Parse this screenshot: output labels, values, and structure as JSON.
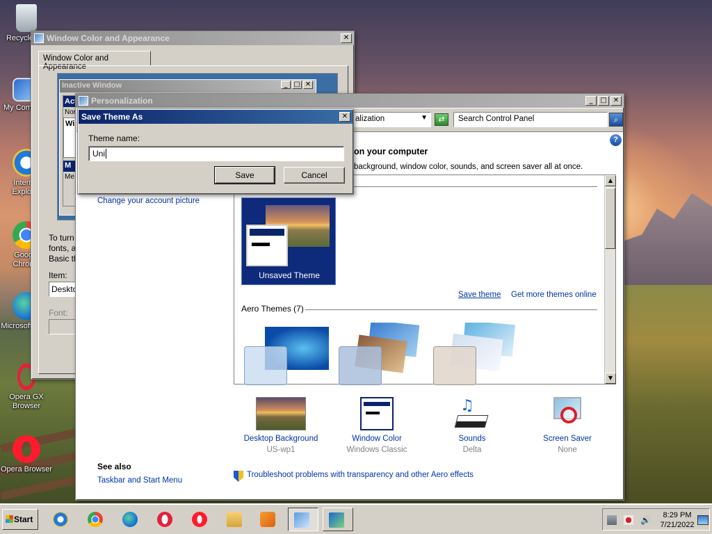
{
  "desktop": {
    "icons": [
      {
        "name": "recycle-bin",
        "label": "Recycle Bin"
      },
      {
        "name": "my-computer",
        "label": "My Computer"
      },
      {
        "name": "internet-explorer",
        "label": "Internet Explorer"
      },
      {
        "name": "google-chrome",
        "label": "Google Chrome"
      },
      {
        "name": "microsoft-edge",
        "label": "Microsoft Edge"
      },
      {
        "name": "opera-gx",
        "label": "Opera GX Browser"
      },
      {
        "name": "opera",
        "label": "Opera Browser"
      }
    ]
  },
  "wca": {
    "title": "Window Color and Appearance",
    "tab": "Window Color and Appearance",
    "preview_inactive": "Inactive Window",
    "preview_active": "Act",
    "preview_normal": "Nor",
    "preview_win": "Win",
    "preview_msg": "M",
    "preview_msg2": "Me",
    "desc_line1": "To turn",
    "desc_line2": "fonts, a",
    "desc_line3": "Basic th",
    "item_label": "Item:",
    "item_value": "Deskto",
    "font_label": "Font:"
  },
  "personalization": {
    "title": "Personalization",
    "breadcrumb": "alization",
    "search_placeholder": "Search Control Panel",
    "heading": "on your computer",
    "subheading": "background, window color, sounds, and screen saver all at once.",
    "left_link": "Change your account picture",
    "unsaved_theme": "Unsaved Theme",
    "save_theme": "Save theme",
    "get_more": "Get more themes online",
    "aero_header": "Aero Themes (7)",
    "bottom_items": [
      {
        "name": "Desktop Background",
        "sub": "US-wp1"
      },
      {
        "name": "Window Color",
        "sub": "Windows Classic"
      },
      {
        "name": "Sounds",
        "sub": "Delta"
      },
      {
        "name": "Screen Saver",
        "sub": "None"
      }
    ],
    "see_also": "See also",
    "see_also_link": "Taskbar and Start Menu",
    "troubleshoot": "Troubleshoot problems with transparency and other Aero effects"
  },
  "dialog": {
    "title": "Save Theme As",
    "label": "Theme name:",
    "value": "Uni",
    "save": "Save",
    "cancel": "Cancel"
  },
  "taskbar": {
    "start": "Start",
    "time": "8:29 PM",
    "date": "7/21/2022"
  }
}
